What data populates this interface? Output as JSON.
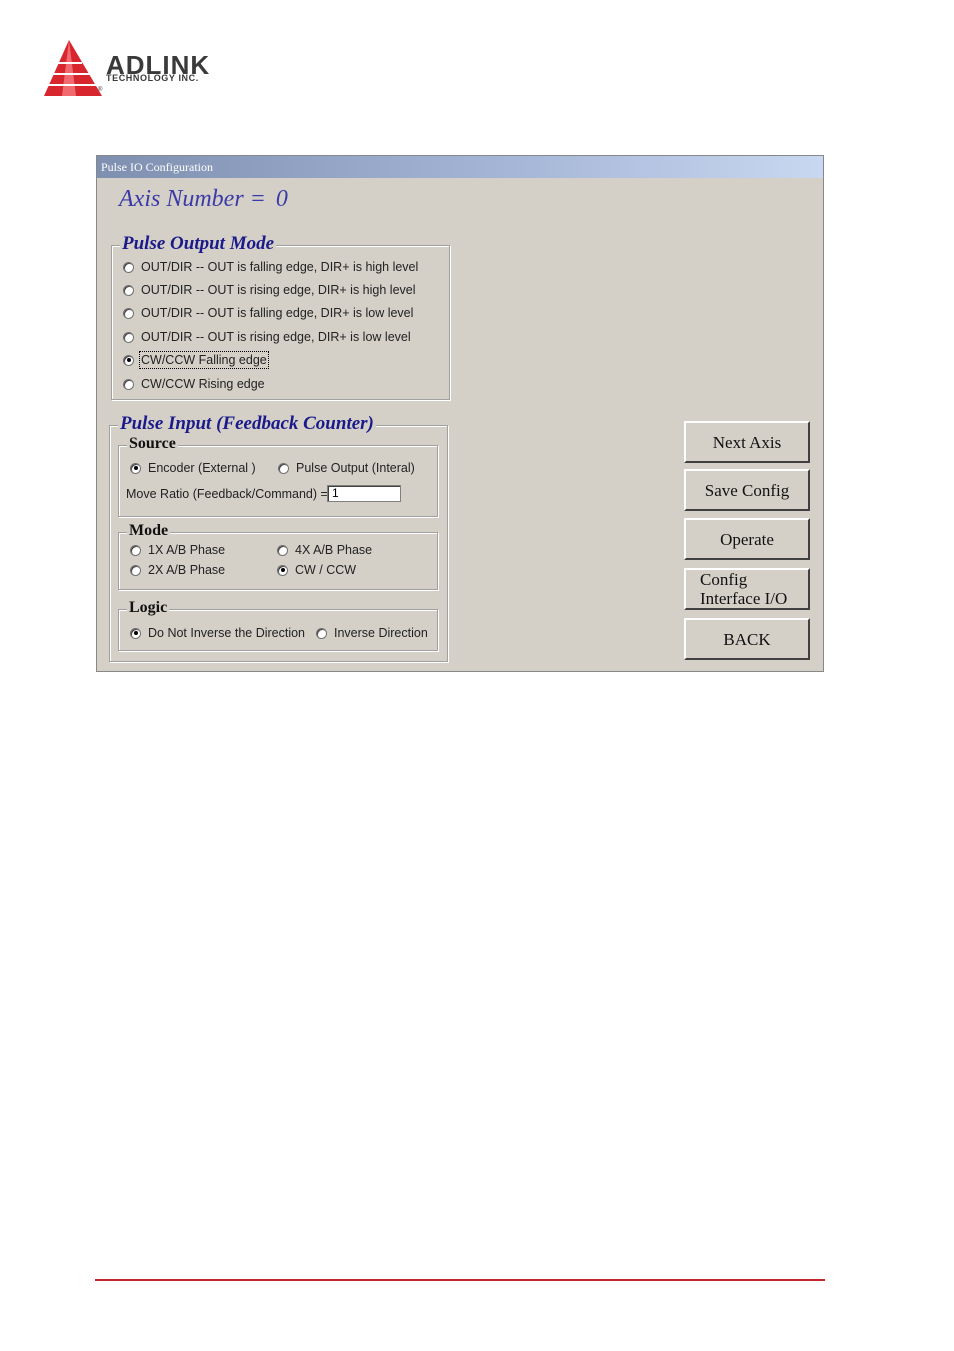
{
  "brand": {
    "name": "ADLINK",
    "sub": "TECHNOLOGY INC.",
    "registered": "®",
    "color": "#d7262e"
  },
  "window": {
    "title": "Pulse IO Configuration",
    "axis_label": "Axis Number =",
    "axis_value": "0"
  },
  "pulse_output": {
    "title": "Pulse Output Mode",
    "options": [
      {
        "label": "OUT/DIR -- OUT is falling edge, DIR+ is high level",
        "selected": false
      },
      {
        "label": "OUT/DIR -- OUT is rising edge, DIR+ is high level",
        "selected": false
      },
      {
        "label": "OUT/DIR -- OUT is falling edge, DIR+ is low level",
        "selected": false
      },
      {
        "label": "OUT/DIR -- OUT is rising edge, DIR+ is low level",
        "selected": false
      },
      {
        "label": "CW/CCW Falling edge",
        "selected": true
      },
      {
        "label": "CW/CCW Rising edge",
        "selected": false
      }
    ]
  },
  "pulse_input": {
    "title": "Pulse Input (Feedback Counter)",
    "source": {
      "title": "Source",
      "options": [
        {
          "label": "Encoder (External )",
          "selected": true
        },
        {
          "label": "Pulse Output (Interal)",
          "selected": false
        }
      ],
      "ratio_label": "Move Ratio (Feedback/Command) =",
      "ratio_value": "1"
    },
    "mode": {
      "title": "Mode",
      "options": [
        {
          "label": "1X A/B Phase",
          "selected": false
        },
        {
          "label": "4X A/B Phase",
          "selected": false
        },
        {
          "label": "2X A/B Phase",
          "selected": false
        },
        {
          "label": "CW / CCW",
          "selected": true
        }
      ]
    },
    "logic": {
      "title": "Logic",
      "options": [
        {
          "label": "Do Not Inverse the Direction",
          "selected": true
        },
        {
          "label": "Inverse Direction",
          "selected": false
        }
      ]
    }
  },
  "buttons": {
    "next_axis": "Next Axis",
    "save_config": "Save Config",
    "operate": "Operate",
    "config_line1": "Config",
    "config_line2": "Interface I/O",
    "back": "BACK"
  }
}
